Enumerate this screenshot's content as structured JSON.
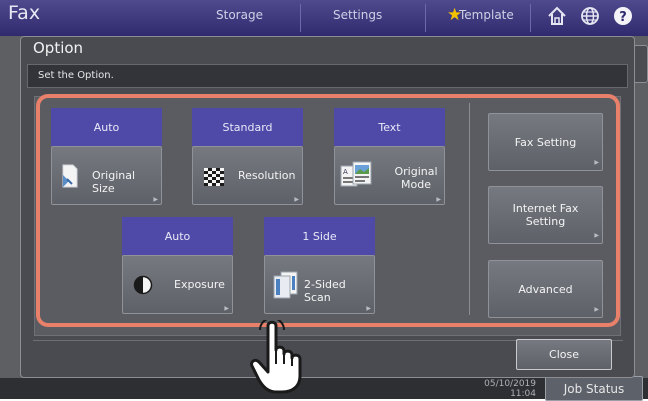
{
  "background": {
    "title": "Fax",
    "tabs": [
      "Storage",
      "Settings",
      "Template"
    ],
    "date": "05/10/2019",
    "time": "11:04",
    "job_status_label": "Job Status"
  },
  "dialog": {
    "title": "Option",
    "message": "Set the Option.",
    "close_label": "Close"
  },
  "settings": [
    {
      "value": "Auto",
      "label": "Original Size",
      "icon": "original-size-icon"
    },
    {
      "value": "Standard",
      "label": "Resolution",
      "icon": "resolution-icon"
    },
    {
      "value": "Text",
      "label": "Original Mode",
      "icon": "original-mode-icon"
    },
    {
      "value": "Auto",
      "label": "Exposure",
      "icon": "exposure-icon"
    },
    {
      "value": "1 Side",
      "label": "2-Sided Scan",
      "icon": "two-sided-scan-icon"
    }
  ],
  "side_buttons": [
    "Fax Setting",
    "Internet Fax Setting",
    "Advanced"
  ],
  "colors": {
    "value_bar": "#4f4aa8",
    "highlight": "#e8806a",
    "header": "#2f2b6e",
    "star": "#f2c200"
  }
}
